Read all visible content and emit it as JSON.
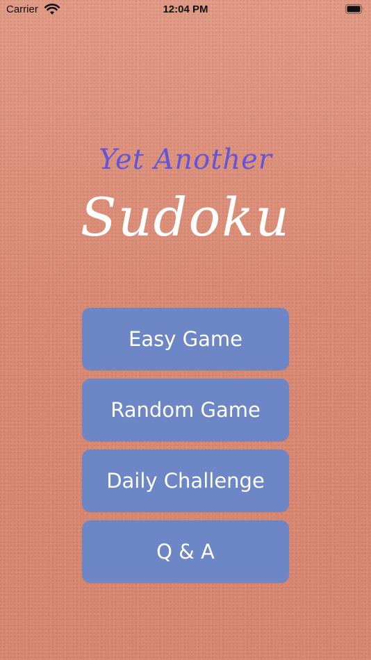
{
  "status_bar": {
    "carrier": "Carrier",
    "time": "12:04 PM",
    "wifi_icon": "wifi-icon",
    "battery_icon": "battery-icon"
  },
  "title": {
    "line1": "Yet Another",
    "line2": "Sudoku"
  },
  "menu": {
    "buttons": [
      {
        "label": "Easy Game"
      },
      {
        "label": "Random Game"
      },
      {
        "label": "Daily Challenge"
      },
      {
        "label": "Q & A"
      }
    ]
  },
  "colors": {
    "background": "#d98a74",
    "button": "#6d86c6",
    "title_top": "#6455d8",
    "title_main": "#ffffff"
  }
}
